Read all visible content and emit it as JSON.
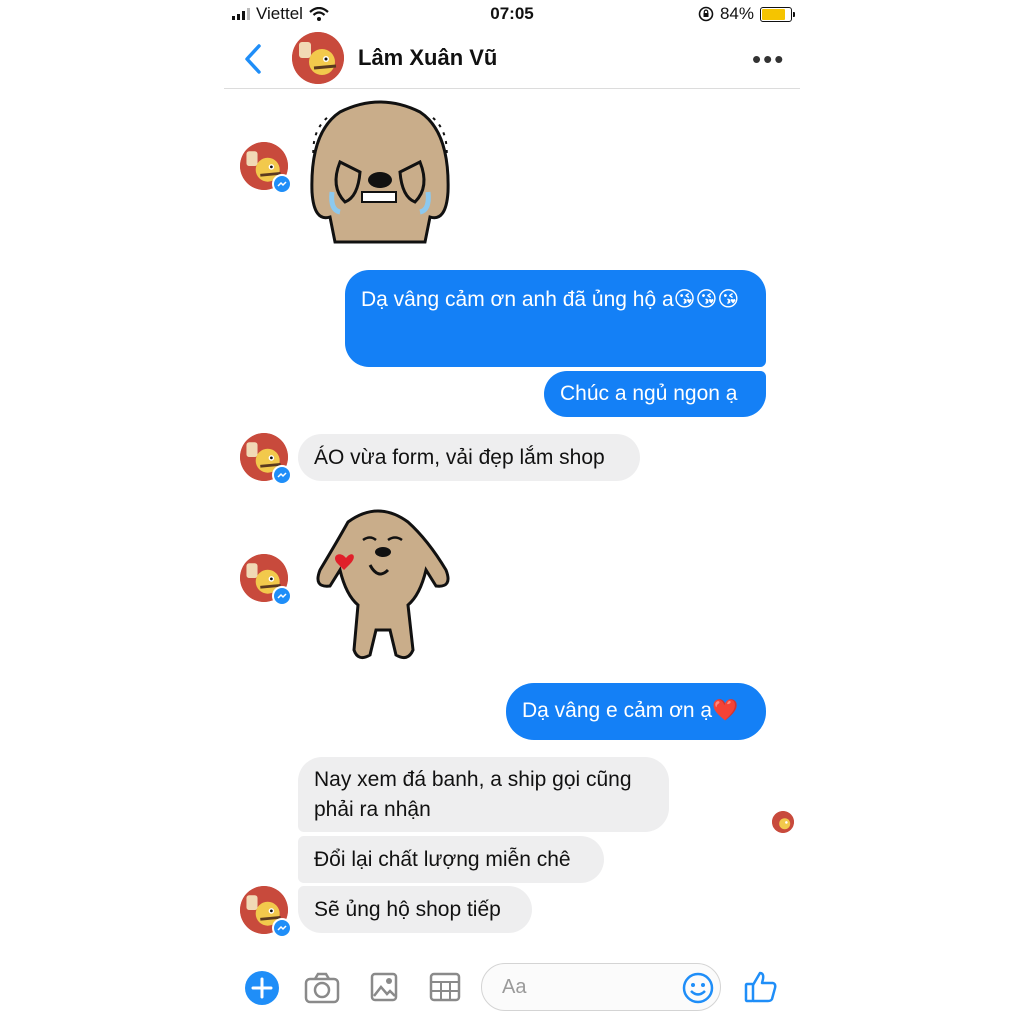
{
  "status_bar": {
    "carrier": "Viettel",
    "time": "07:05",
    "battery": "84%",
    "battery_level": 0.84
  },
  "header": {
    "contact_name": "Lâm Xuân Vũ"
  },
  "messages": [
    {
      "type": "sticker",
      "direction": "incoming",
      "sticker": "dog-crying-sticker"
    },
    {
      "type": "text",
      "direction": "outgoing",
      "text": "Dạ vâng cảm ơn anh đã ủng hộ a😘😘😘"
    },
    {
      "type": "text",
      "direction": "outgoing",
      "text": "Chúc a ngủ ngon ạ"
    },
    {
      "type": "text",
      "direction": "incoming",
      "text": "ÁO vừa form, vải đẹp lắm shop"
    },
    {
      "type": "sticker",
      "direction": "incoming",
      "sticker": "dog-kiss-sticker"
    },
    {
      "type": "text",
      "direction": "outgoing",
      "text": "Dạ vâng e cảm ơn ạ❤️"
    },
    {
      "type": "text",
      "direction": "incoming",
      "text": "Nay xem đá banh, a ship gọi cũng phải ra nhận"
    },
    {
      "type": "text",
      "direction": "incoming",
      "text": "Đổi lại chất lượng miễn chê"
    },
    {
      "type": "text",
      "direction": "incoming",
      "text": "Sẽ ủng hộ shop tiếp"
    }
  ],
  "composer": {
    "placeholder": "Aa"
  },
  "colors": {
    "accent": "#1480f6",
    "incoming_bubble": "#eeeeef",
    "avatar_bg": "#c84a3c",
    "sticker_fill": "#c9ad8a"
  },
  "icons": [
    "back-chevron-icon",
    "more-icon",
    "plus-icon",
    "camera-icon",
    "gallery-icon",
    "grid-icon",
    "emoji-icon",
    "like-icon"
  ]
}
